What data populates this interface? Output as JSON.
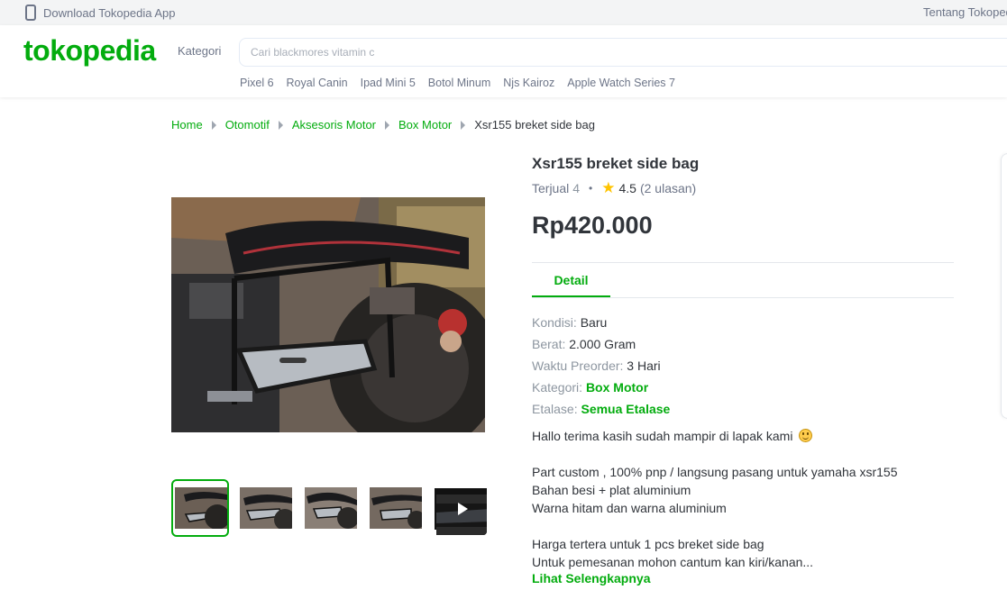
{
  "topbar": {
    "download_label": "Download Tokopedia App",
    "about_label": "Tentang Tokopedia"
  },
  "header": {
    "logo_text": "tokopedia",
    "kategori_label": "Kategori",
    "search_placeholder": "Cari blackmores vitamin c",
    "hot_keywords": [
      "Pixel 6",
      "Royal Canin",
      "Ipad Mini 5",
      "Botol Minum",
      "Njs Kairoz",
      "Apple Watch Series 7"
    ]
  },
  "breadcrumb": [
    "Home",
    "Otomotif",
    "Aksesoris Motor",
    "Box Motor",
    "Xsr155 breket side bag"
  ],
  "product": {
    "title": "Xsr155 breket side bag",
    "sold_label": "Terjual",
    "sold_count": "4",
    "rating": "4.5",
    "reviews": "(2 ulasan)",
    "price": "Rp420.000"
  },
  "tabs": {
    "detail_label": "Detail"
  },
  "specs": [
    {
      "key": "Kondisi: ",
      "value": "Baru",
      "link": false
    },
    {
      "key": "Berat: ",
      "value": "2.000 Gram",
      "link": false
    },
    {
      "key": "Waktu Preorder: ",
      "value": "3 Hari",
      "link": false
    },
    {
      "key": "Kategori: ",
      "value": "Box Motor",
      "link": true
    },
    {
      "key": "Etalase: ",
      "value": "Semua Etalase",
      "link": true
    }
  ],
  "description": {
    "greeting": "Hallo terima kasih sudah mampir di lapak kami",
    "line1": "Part custom , 100% pnp / langsung pasang untuk yamaha xsr155",
    "line2": "Bahan besi + plat aluminium",
    "line3": "Warna hitam dan warna aluminium",
    "line4": "Harga tertera untuk 1 pcs breket side bag",
    "line5": "Untuk pemesanan mohon cantum kan kiri/kanan...",
    "see_more": "Lihat Selengkapnya"
  },
  "colors": {
    "brand": "#03ac0e",
    "text": "#31353b",
    "muted": "#6d7588",
    "star": "#ffc400"
  },
  "icons": [
    "phone-icon",
    "chevron-right-icon",
    "star-icon",
    "smile-icon",
    "play-icon"
  ]
}
